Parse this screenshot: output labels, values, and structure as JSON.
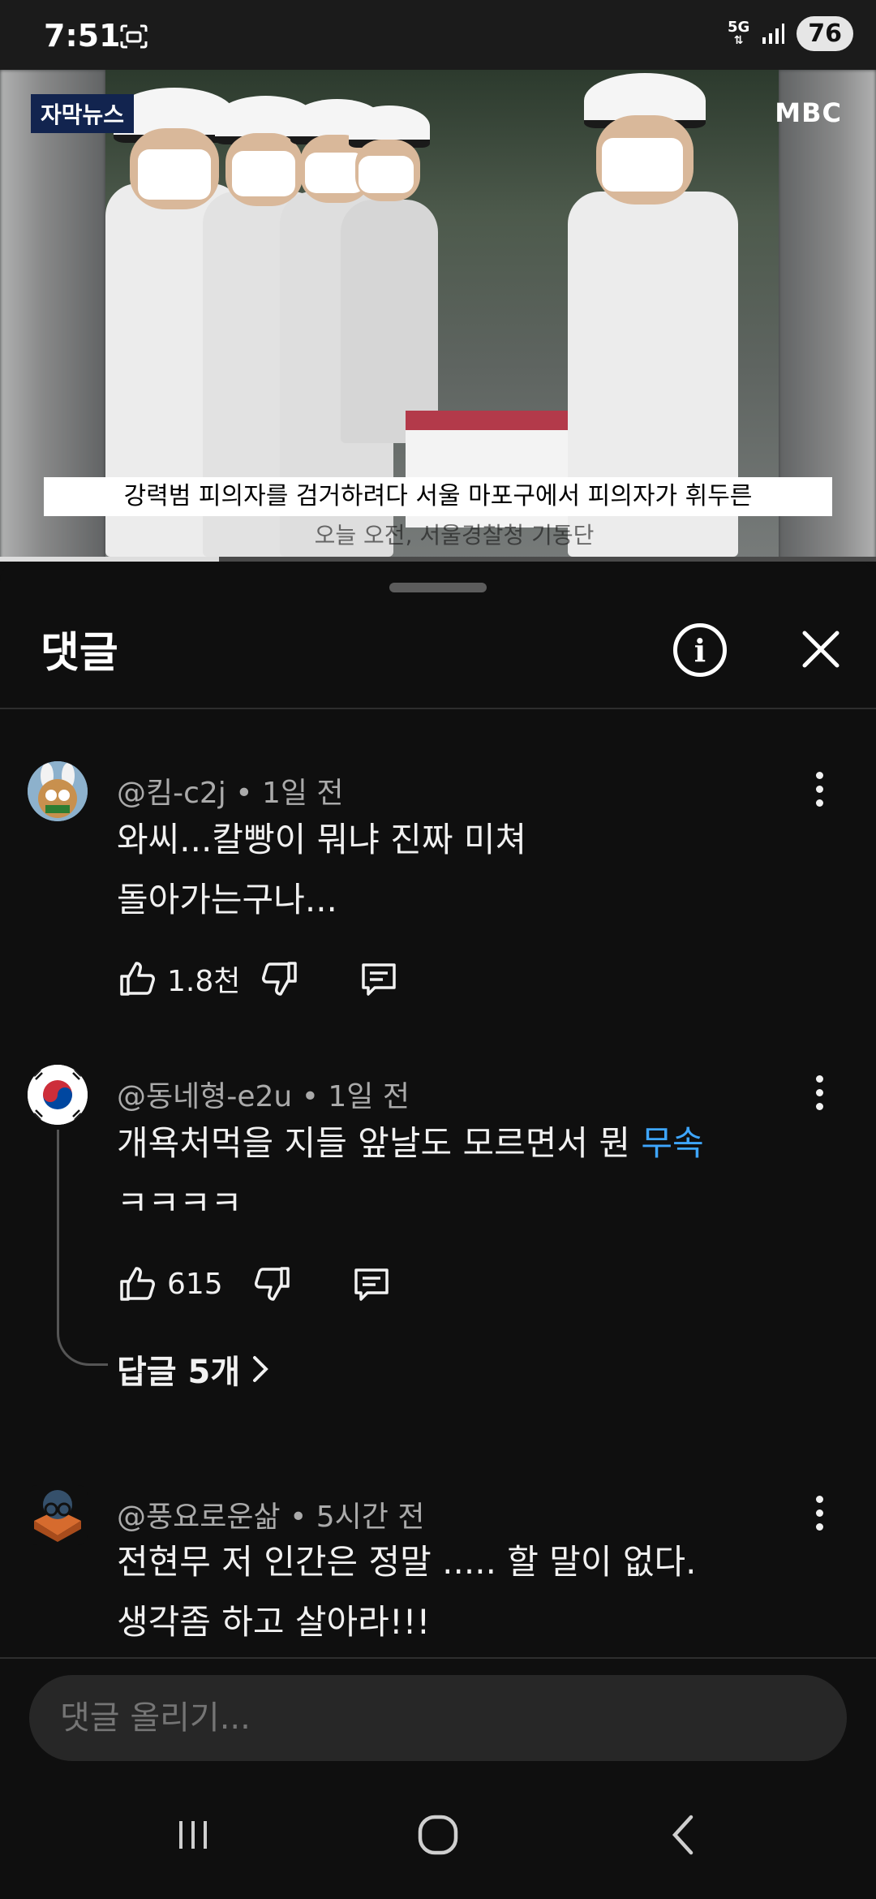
{
  "status_bar": {
    "time": "7:51",
    "network": "5G",
    "battery": "76"
  },
  "video": {
    "news_tag": "자막뉴스",
    "channel_logo": "MBC",
    "subtitle": "강력범 피의자를 검거하려다 서울 마포구에서 피의자가 휘두른",
    "subtitle_under": "오늘 오전, 서울경찰청 기동단",
    "progress": 0.25
  },
  "comments_sheet": {
    "title": "댓글",
    "comments": [
      {
        "author": "@킴-c2j",
        "time": "1일 전",
        "text_line1": "와씨...칼빵이 뭐냐 진짜 미쳐",
        "text_line2": "돌아가는구나...",
        "likes": "1.8천"
      },
      {
        "author": "@동네형-e2u",
        "time": "1일 전",
        "text_line1": "개욕처먹을 지들 앞날도 모르면서 뭔 ",
        "text_link": "무속",
        "text_line2": "ㅋㅋㅋㅋ",
        "likes": "615",
        "replies": "답글 5개"
      },
      {
        "author": "@풍요로운삶",
        "time": "5시간 전",
        "text_line1": "전현무 저 인간은 정말 ..... 할 말이 없다.",
        "text_line2": "생각좀 하고 살아라!!!"
      }
    ],
    "input_placeholder": "댓글 올리기..."
  },
  "colors": {
    "background": "#0f0f0f",
    "link": "#3ea6ff",
    "meta_text": "#aaaaaa"
  }
}
